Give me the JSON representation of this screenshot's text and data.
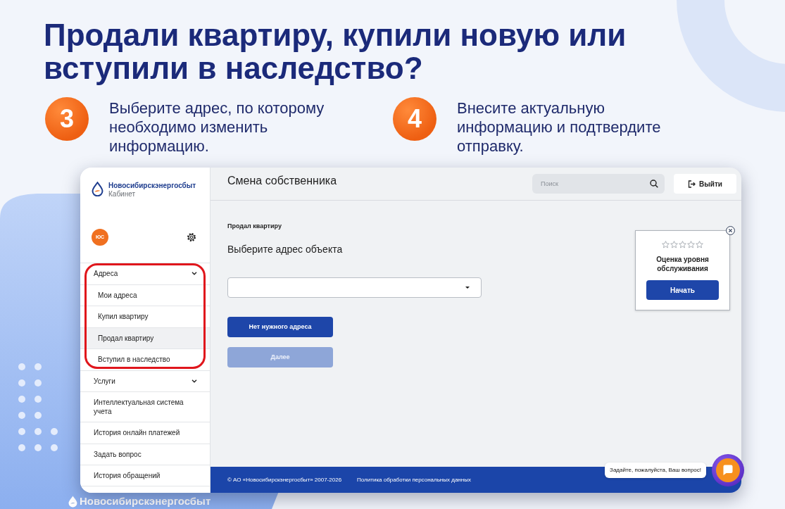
{
  "headline": "Продали квартиру, купили новую или вступили в наследство?",
  "steps": [
    {
      "number": "3",
      "text": "Выберите адрес, по которому необходимо изменить информацию."
    },
    {
      "number": "4",
      "text": "Внесите актуальную информацию и подтвердите отправку."
    }
  ],
  "app": {
    "sidebar": {
      "brand": "Новосибирскэнергосбыт",
      "subtitle": "Кабинет",
      "avatar": "ЮС",
      "items": [
        {
          "kind": "group",
          "label": "Адреса",
          "selected": false,
          "expanded": true,
          "highlighted": true,
          "children": [
            {
              "label": "Мои адреса",
              "selected": false
            },
            {
              "label": "Купил квартиру",
              "selected": false
            },
            {
              "label": "Продал квартиру",
              "selected": true
            },
            {
              "label": "Вступил в наследство",
              "selected": false
            }
          ]
        },
        {
          "kind": "group",
          "label": "Услуги",
          "selected": false,
          "highlighted": false
        },
        {
          "kind": "link",
          "label": "Интеллектуальная система учета",
          "selected": false,
          "highlighted": false
        },
        {
          "kind": "link",
          "label": "История онлайн платежей",
          "selected": false,
          "highlighted": false
        },
        {
          "kind": "link",
          "label": "Задать вопрос",
          "selected": false,
          "highlighted": false
        },
        {
          "kind": "link",
          "label": "История обращений",
          "selected": false,
          "highlighted": false
        }
      ]
    },
    "header": {
      "title": "Смена собственника",
      "search": {
        "placeholder": "Поиск"
      },
      "logout_button": "Выйти"
    },
    "form": {
      "section": "Продал квартиру",
      "heading": "Выберите адрес объекта",
      "buttons": [
        {
          "label": "Нет нужного адреса",
          "disabled": false
        },
        {
          "label": "Далее",
          "disabled": true
        }
      ]
    },
    "rating_widget": {
      "stars": 0,
      "title": "Оценка уровня обслуживания",
      "button": "Начать"
    },
    "footer": {
      "copyright": "© АО «Новосибирскэнергосбыт» 2007-2026",
      "policy_link": "Политика обработки персональных данных"
    },
    "chat": {
      "prompt": "Задайте, пожалуйста, Ваш вопрос!"
    }
  },
  "footer_brand": "Новосибирскэнергосбыт"
}
